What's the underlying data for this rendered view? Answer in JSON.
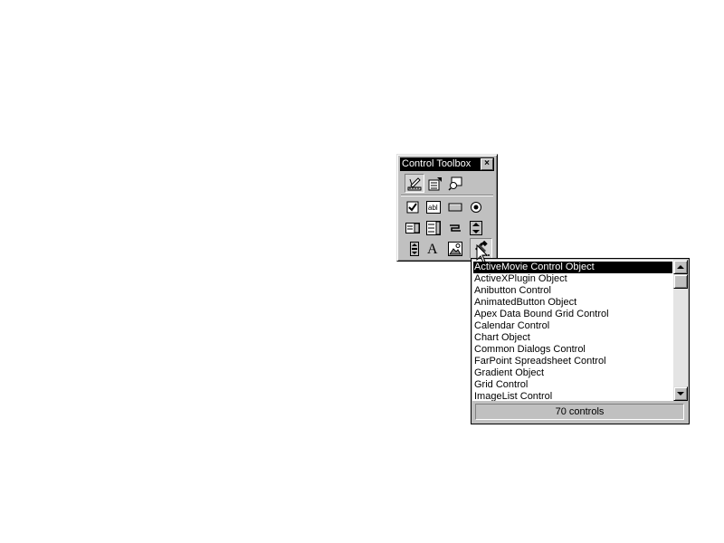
{
  "toolbox": {
    "title": "Control Toolbox",
    "close_glyph": "×",
    "top_tools": [
      {
        "icon": "design-mode-icon",
        "pressed": true
      },
      {
        "icon": "properties-icon",
        "pressed": false
      },
      {
        "icon": "view-code-icon",
        "pressed": false
      }
    ],
    "controls": [
      {
        "icon": "check-box-icon"
      },
      {
        "icon": "text-box-icon",
        "text": "abl"
      },
      {
        "icon": "command-button-icon"
      },
      {
        "icon": "option-button-icon"
      },
      {
        "icon": "list-box-icon"
      },
      {
        "icon": "combo-box-icon"
      },
      {
        "icon": "toggle-button-icon"
      },
      {
        "icon": "spin-button-icon"
      },
      {
        "icon": "scroll-bar-icon"
      },
      {
        "icon": "label-icon",
        "text": "A"
      },
      {
        "icon": "image-icon"
      },
      {
        "icon": "more-controls-icon",
        "pressed": true
      }
    ]
  },
  "more_controls": {
    "items": [
      "ActiveMovie Control Object",
      "ActiveXPlugin Object",
      "Anibutton Control",
      "AnimatedButton Object",
      "Apex Data Bound Grid Control",
      "Calendar Control",
      "Chart Object",
      "Common Dialogs Control",
      "FarPoint Spreadsheet Control",
      "Gradient Object",
      "Grid Control",
      "ImageList Control"
    ],
    "selected_index": 0,
    "status": "70 controls"
  }
}
